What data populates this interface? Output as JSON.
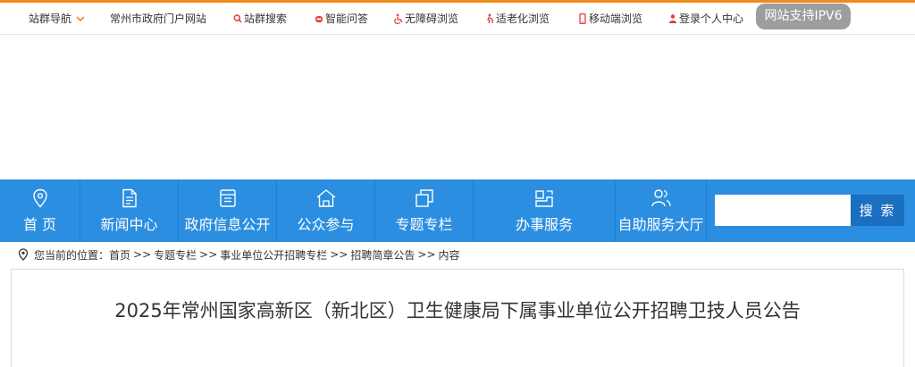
{
  "topbar": {
    "station_nav": "站群导航",
    "portal": "常州市政府门户网站",
    "station_search": "站群搜索",
    "smart_qa": "智能问答",
    "accessible": "无障碍浏览",
    "elderly": "适老化浏览",
    "mobile": "移动端浏览",
    "login": "登录个人中心",
    "ipv6": "网站支持IPV6"
  },
  "nav": {
    "items": [
      {
        "label": "首 页",
        "icon": "location-pin-icon"
      },
      {
        "label": "新闻中心",
        "icon": "document-icon"
      },
      {
        "label": "政府信息公开",
        "icon": "info-panel-icon"
      },
      {
        "label": "公众参与",
        "icon": "house-icon"
      },
      {
        "label": "专题专栏",
        "icon": "stacked-squares-icon"
      },
      {
        "label": "办事服务",
        "icon": "service-icon"
      },
      {
        "label": "自助服务大厅",
        "icon": "people-icon"
      }
    ],
    "search_placeholder": "",
    "search_button": "搜 索"
  },
  "breadcrumb": {
    "prefix": "您当前的位置：",
    "items": [
      "首页",
      "专题专栏",
      "事业单位公开招聘专栏",
      "招聘简章公告",
      "内容"
    ],
    "separator": ">>"
  },
  "article": {
    "title": "2025年常州国家高新区（新北区）卫生健康局下属事业单位公开招聘卫技人员公告"
  },
  "colors": {
    "accent_orange": "#f08c1e",
    "nav_blue": "#2c8ee0",
    "search_blue": "#1b6fc0",
    "icon_red": "#e23a3a"
  }
}
